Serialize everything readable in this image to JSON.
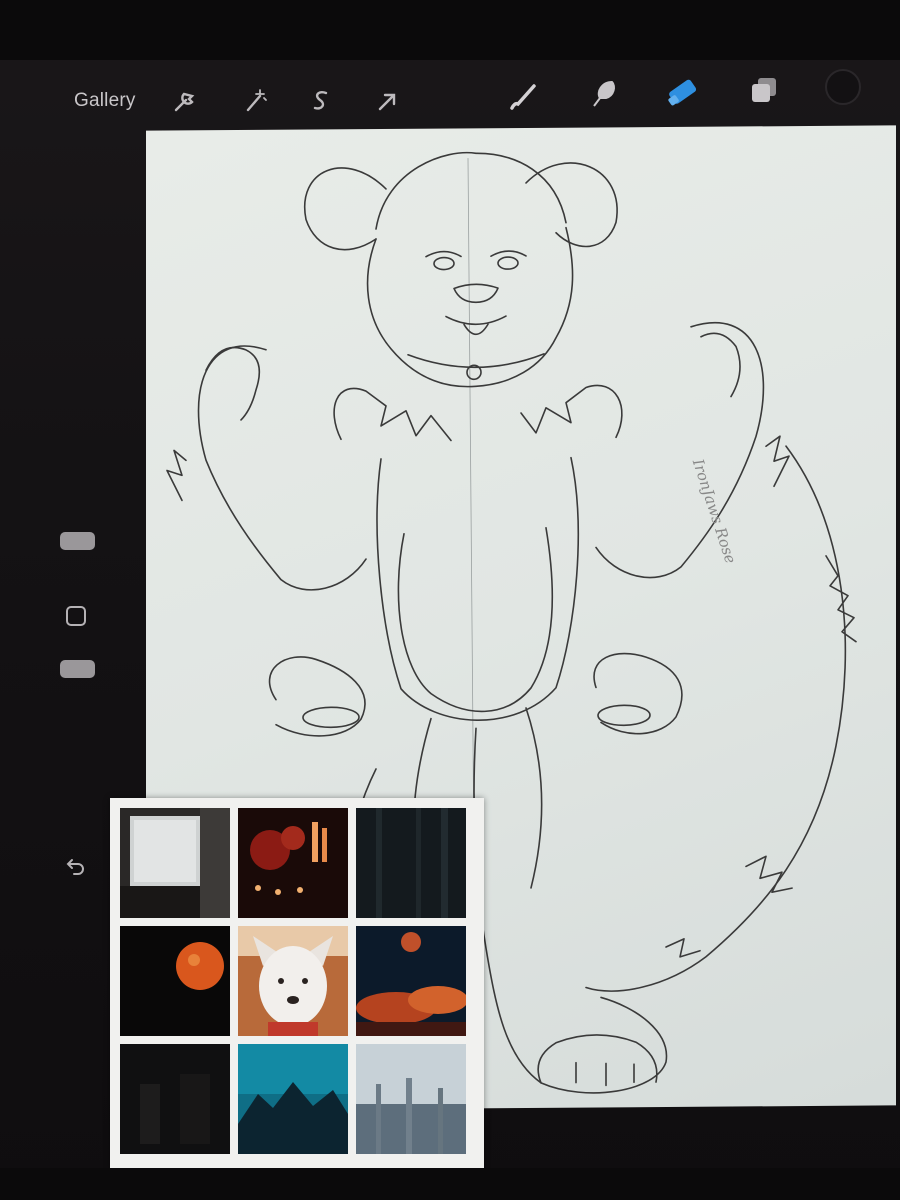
{
  "toolbar": {
    "gallery_label": "Gallery",
    "left_tools": [
      "wrench-icon",
      "magic-wand-icon",
      "selection-icon",
      "transform-arrow-icon"
    ],
    "right_tools": [
      "brush-icon",
      "smudge-icon",
      "eraser-icon",
      "layers-icon",
      "color-swatch-icon"
    ],
    "active_tool": "eraser",
    "accent_color": "#2e8fe0"
  },
  "sidebar": {
    "controls": [
      "brush-size-slider",
      "modify-button",
      "opacity-slider",
      "undo-button"
    ]
  },
  "canvas": {
    "subject": "dog-lineart-sketch",
    "signature": "IronJaws Rose"
  },
  "reference_panel": {
    "thumbnails": [
      "window-frost",
      "red-apples-candles",
      "dark-forest",
      "orange-moon",
      "white-dog",
      "red-moon-clouds",
      "dark-room",
      "teal-mountain-night",
      "fog-forest"
    ]
  }
}
